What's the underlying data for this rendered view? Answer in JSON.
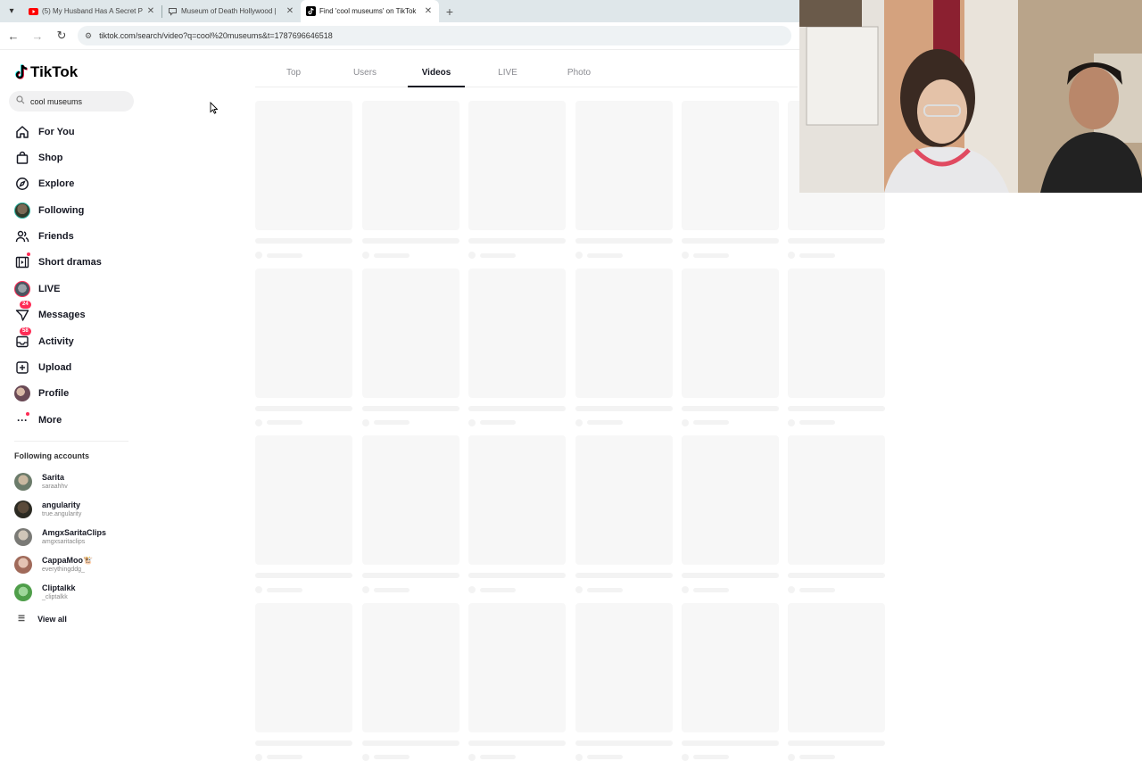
{
  "browser": {
    "tabs": [
      {
        "title": "(5) My Husband Has A Secret P",
        "icon": "youtube-icon",
        "active": false
      },
      {
        "title": "Museum of Death Hollywood |",
        "icon": "chat-icon",
        "active": false
      },
      {
        "title": "Find 'cool museums' on TikTok",
        "icon": "tiktok-icon",
        "active": true
      }
    ],
    "url": "tiktok.com/search/video?q=cool%20museums&t=1787696646518"
  },
  "sidebar": {
    "logo": "TikTok",
    "search_value": "cool museums",
    "menu": [
      {
        "label": "For You",
        "icon": "home-icon"
      },
      {
        "label": "Shop",
        "icon": "shopping-bag-icon"
      },
      {
        "label": "Explore",
        "icon": "compass-icon"
      },
      {
        "label": "Following",
        "icon": "following-avatar-icon"
      },
      {
        "label": "Friends",
        "icon": "friends-icon"
      },
      {
        "label": "Short dramas",
        "icon": "film-icon"
      },
      {
        "label": "LIVE",
        "icon": "live-avatar-icon"
      },
      {
        "label": "Messages",
        "icon": "paper-plane-icon",
        "badge": "24"
      },
      {
        "label": "Activity",
        "icon": "inbox-icon",
        "badge": "58"
      },
      {
        "label": "Upload",
        "icon": "plus-square-icon"
      },
      {
        "label": "Profile",
        "icon": "profile-avatar-icon"
      },
      {
        "label": "More",
        "icon": "more-dots-icon"
      }
    ],
    "following_title": "Following accounts",
    "accounts": [
      {
        "name": "Sarita",
        "username": "saraahhv",
        "color": "#6b7b6a"
      },
      {
        "name": "angularity",
        "username": "true.angularity",
        "color": "#3b3a2f"
      },
      {
        "name": "AmgxSaritaClips",
        "username": "amgxsaritaclips",
        "color": "#8a8a86"
      },
      {
        "name": "CappaMoo🐮",
        "username": "everythingddg_",
        "color": "#b07a6a"
      },
      {
        "name": "Cliptalkk",
        "username": "_cliptalkk",
        "color": "#5fae5a"
      }
    ],
    "view_all": "View all"
  },
  "search_tabs": [
    "Top",
    "Users",
    "Videos",
    "LIVE",
    "Photo"
  ],
  "active_search_tab": "Videos",
  "colors": {
    "accent": "#fe2c55",
    "text": "#161823",
    "muted": "#8a8b91"
  }
}
